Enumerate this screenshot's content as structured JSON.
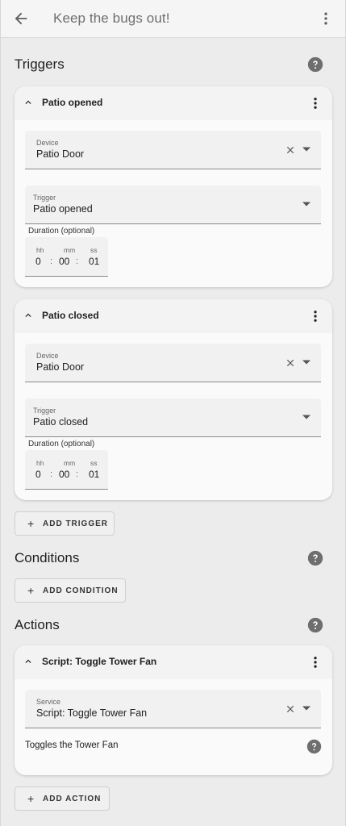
{
  "header": {
    "title": "Keep the bugs out!"
  },
  "sections": {
    "triggers": "Triggers",
    "conditions": "Conditions",
    "actions": "Actions"
  },
  "triggers": [
    {
      "title": "Patio opened",
      "device_label": "Device",
      "device_value": "Patio Door",
      "trigger_label": "Trigger",
      "trigger_value": "Patio opened",
      "duration_label": "Duration (optional)",
      "hh_label": "hh",
      "mm_label": "mm",
      "ss_label": "ss",
      "hh": "0",
      "mm": "00",
      "ss": "01"
    },
    {
      "title": "Patio closed",
      "device_label": "Device",
      "device_value": "Patio Door",
      "trigger_label": "Trigger",
      "trigger_value": "Patio closed",
      "duration_label": "Duration (optional)",
      "hh_label": "hh",
      "mm_label": "mm",
      "ss_label": "ss",
      "hh": "0",
      "mm": "00",
      "ss": "01"
    }
  ],
  "buttons": {
    "add_trigger": "ADD TRIGGER",
    "add_condition": "ADD CONDITION",
    "add_action": "ADD ACTION"
  },
  "action": {
    "title": "Script: Toggle Tower Fan",
    "service_label": "Service",
    "service_value": "Script: Toggle Tower Fan",
    "description": "Toggles the Tower Fan"
  },
  "separator": ":",
  "icons": {
    "back": "arrow-left-icon",
    "menu": "more-vertical-icon",
    "help": "help-circle-icon",
    "chevron": "chevron-up-icon",
    "clear": "close-icon",
    "dropdown": "caret-down-icon",
    "plus": "plus-icon"
  },
  "colors": {
    "background": "#ececec",
    "card": "#fafafa",
    "icon": "#6e6e6e"
  }
}
